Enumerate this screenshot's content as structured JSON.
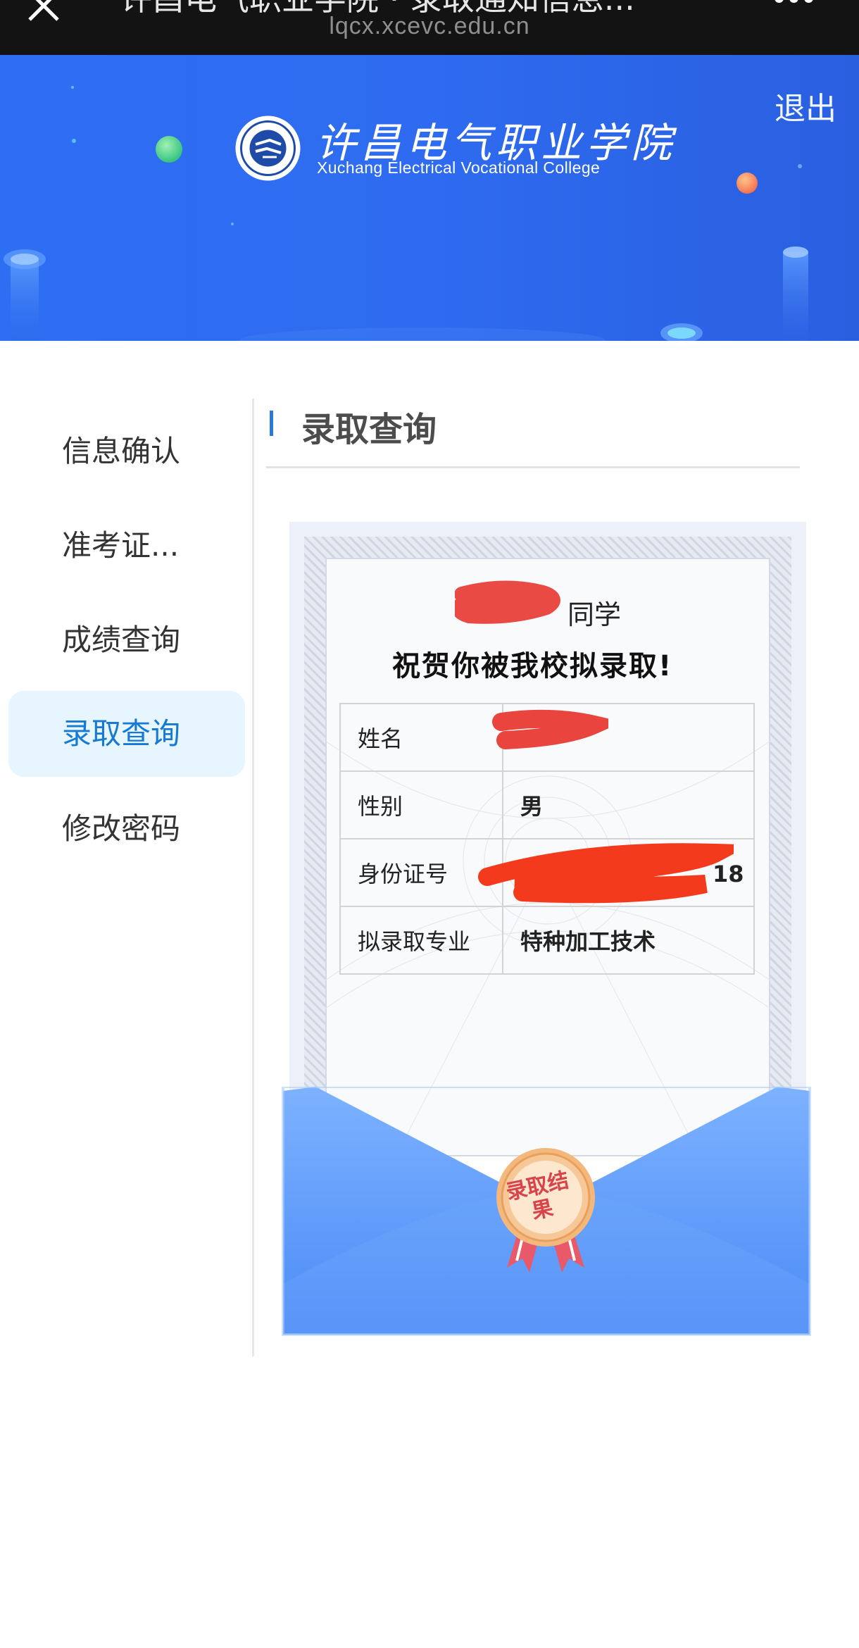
{
  "browser": {
    "title_fragment": "许昌电气职业学院 · 录取通知信息...",
    "url": "lqcx.xcevc.edu.cn",
    "icons": {
      "close": "close-icon",
      "more": "more-icon"
    }
  },
  "header": {
    "logout_label": "退出",
    "college_name_cn": "许昌电气职业学院",
    "college_name_en": "Xuchang Electrical Vocational College",
    "logo_icon": "college-logo-icon"
  },
  "sidebar": {
    "items": [
      {
        "label": "信息确认",
        "active": false
      },
      {
        "label": "准考证...",
        "active": false
      },
      {
        "label": "成绩查询",
        "active": false
      },
      {
        "label": "录取查询",
        "active": true
      },
      {
        "label": "修改密码",
        "active": false
      }
    ]
  },
  "main": {
    "section_title": "录取查询",
    "certificate": {
      "student_suffix": "同学",
      "congrats": "祝贺你被我校拟录取!",
      "rows": [
        {
          "key": "姓名",
          "value": ""
        },
        {
          "key": "性别",
          "value": "男"
        },
        {
          "key": "身份证号",
          "value": ""
        },
        {
          "key": "拟录取专业",
          "value": "特种加工技术"
        }
      ],
      "id_tail": "18",
      "seal_text": "录取结果"
    }
  },
  "colors": {
    "banner_blue": "#2d6ef2",
    "active_bg": "#e6f5fe",
    "active_text": "#1679d3",
    "redaction": "#e9443e",
    "envelope_blue": "#6aa4fb"
  }
}
